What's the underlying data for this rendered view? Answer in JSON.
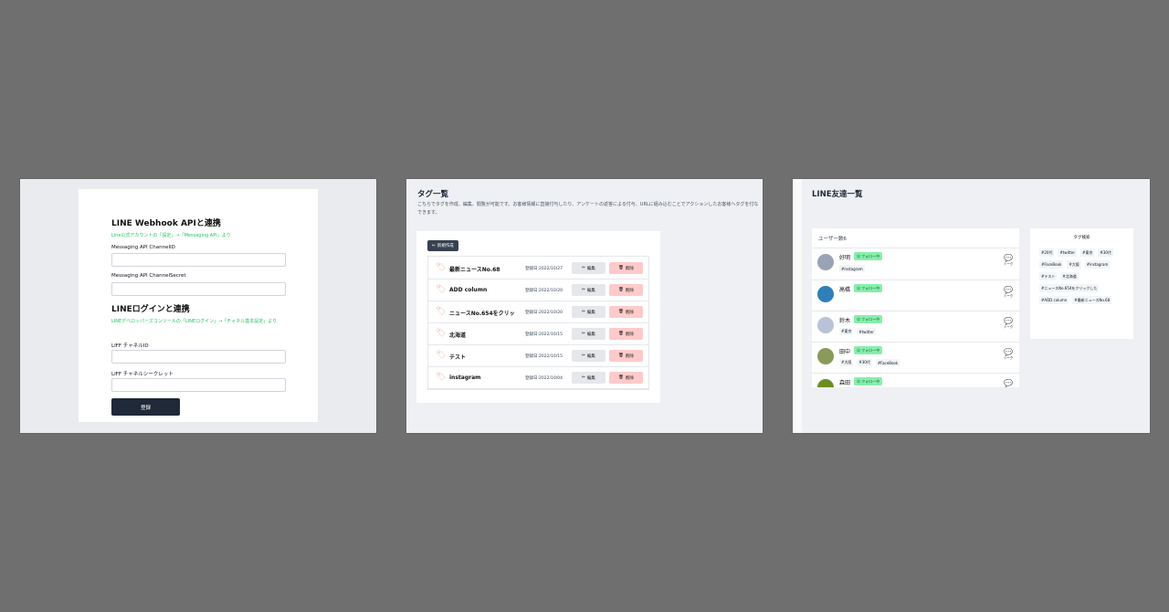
{
  "webhook": {
    "title1": "LINE Webhook APIと連携",
    "hint1": "Line公式アカウントの「設定」→「Messaging API」より",
    "label_channel_id": "Messaging API ChannelID",
    "label_channel_secret": "Messaging API ChannelSecret",
    "title2": "LINEログインと連携",
    "hint2": "LINEデベロッパーズコンソールの「LINEログイン」→「チャネル基本設定」より",
    "label_liff_id": "LIFF チャネルID",
    "label_liff_secret": "LIFF チャネルシークレット",
    "submit_label": "登録"
  },
  "tags": {
    "title": "タグ一覧",
    "description": "こちらでタグを作成、編集、閲覧が可能です。お客様情報に直接付与したり、アンケートの返答による付与、URLに組み込むことでアクションしたお客様へタグを付なできます。",
    "new_label": "新規作成",
    "edit_label": "編集",
    "delete_label": "削除",
    "rows": [
      {
        "name": "最新ニュースNo.68",
        "date": "登録日:2022/10/27"
      },
      {
        "name": "ADD column",
        "date": "登録日:2022/10/20"
      },
      {
        "name": "ニュースNo.654をクリッ",
        "date": "登録日:2022/10/20"
      },
      {
        "name": "北海道",
        "date": "登録日:2022/10/15"
      },
      {
        "name": "テスト",
        "date": "登録日:2022/10/15"
      },
      {
        "name": "instagram",
        "date": "登録日:2022/10/04"
      }
    ]
  },
  "friends": {
    "title": "LINE友達一覧",
    "count": "ユーザー数6",
    "follow_label": "フォロー中",
    "talk_label": "トーク",
    "users": [
      {
        "name": "好明",
        "tags": [
          "#instagram"
        ],
        "avatar_color": "#9aa3b5"
      },
      {
        "name": "高橋",
        "tags": [],
        "avatar_color": "#2f7fb8"
      },
      {
        "name": "鈴木",
        "tags": [
          "#東京",
          "#twitter"
        ],
        "avatar_color": "#b9c3d8"
      },
      {
        "name": "田中",
        "tags": [
          "#大阪",
          "#30代",
          "#FaceBook"
        ],
        "avatar_color": "#8a9a5b"
      },
      {
        "name": "森田",
        "tags": [],
        "avatar_color": "#6b8e23"
      }
    ],
    "search_title": "タグ検索",
    "search_tags": [
      "#20代",
      "#twitter",
      "#東京",
      "#30代",
      "#FaceBook",
      "#大阪",
      "#instagram",
      "#テスト",
      "#北海道",
      "#ニュースNo.654をクリックした",
      "#ADD column",
      "#最新ニュースNo.68"
    ]
  }
}
